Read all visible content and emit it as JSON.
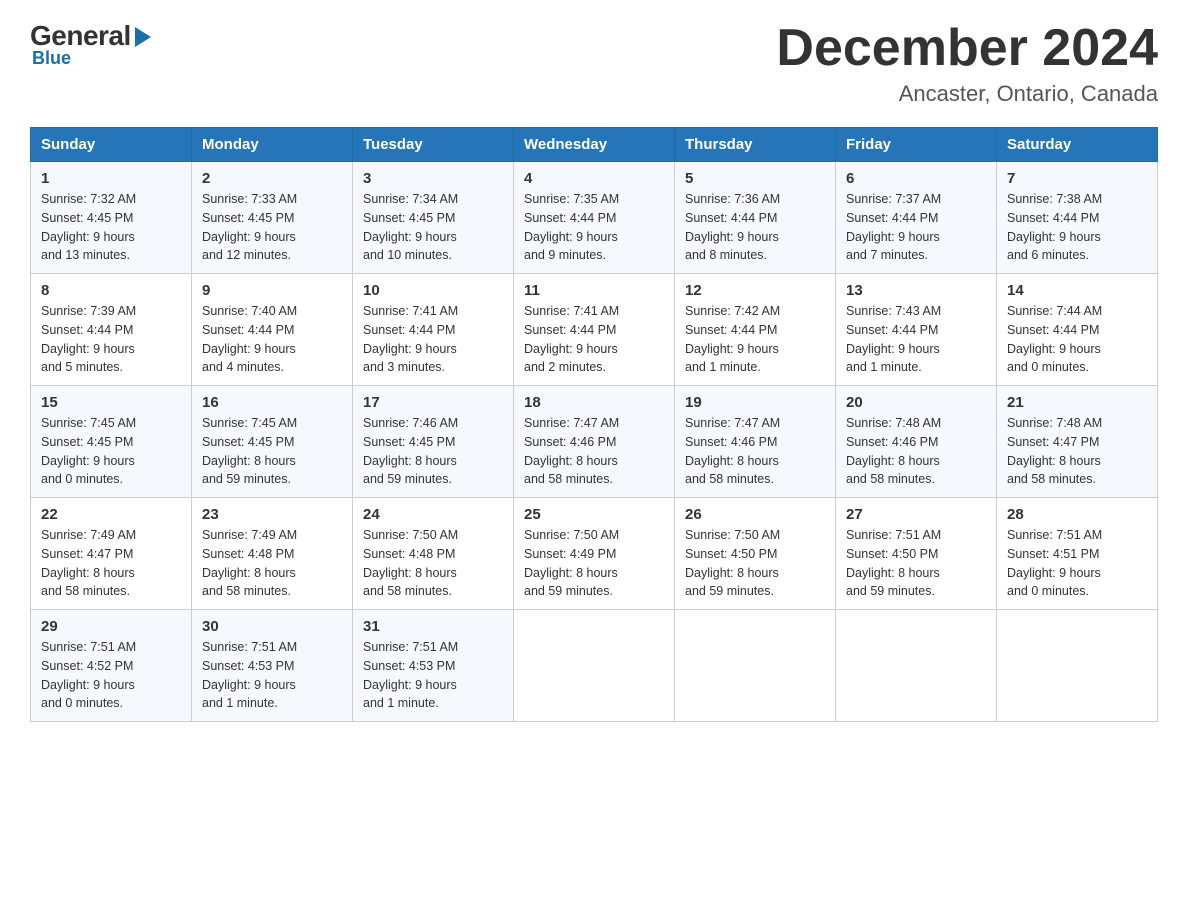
{
  "header": {
    "logo_general": "General",
    "logo_blue": "Blue",
    "month_year": "December 2024",
    "location": "Ancaster, Ontario, Canada"
  },
  "days_of_week": [
    "Sunday",
    "Monday",
    "Tuesday",
    "Wednesday",
    "Thursday",
    "Friday",
    "Saturday"
  ],
  "weeks": [
    [
      {
        "day": "1",
        "sunrise": "7:32 AM",
        "sunset": "4:45 PM",
        "daylight": "9 hours and 13 minutes."
      },
      {
        "day": "2",
        "sunrise": "7:33 AM",
        "sunset": "4:45 PM",
        "daylight": "9 hours and 12 minutes."
      },
      {
        "day": "3",
        "sunrise": "7:34 AM",
        "sunset": "4:45 PM",
        "daylight": "9 hours and 10 minutes."
      },
      {
        "day": "4",
        "sunrise": "7:35 AM",
        "sunset": "4:44 PM",
        "daylight": "9 hours and 9 minutes."
      },
      {
        "day": "5",
        "sunrise": "7:36 AM",
        "sunset": "4:44 PM",
        "daylight": "9 hours and 8 minutes."
      },
      {
        "day": "6",
        "sunrise": "7:37 AM",
        "sunset": "4:44 PM",
        "daylight": "9 hours and 7 minutes."
      },
      {
        "day": "7",
        "sunrise": "7:38 AM",
        "sunset": "4:44 PM",
        "daylight": "9 hours and 6 minutes."
      }
    ],
    [
      {
        "day": "8",
        "sunrise": "7:39 AM",
        "sunset": "4:44 PM",
        "daylight": "9 hours and 5 minutes."
      },
      {
        "day": "9",
        "sunrise": "7:40 AM",
        "sunset": "4:44 PM",
        "daylight": "9 hours and 4 minutes."
      },
      {
        "day": "10",
        "sunrise": "7:41 AM",
        "sunset": "4:44 PM",
        "daylight": "9 hours and 3 minutes."
      },
      {
        "day": "11",
        "sunrise": "7:41 AM",
        "sunset": "4:44 PM",
        "daylight": "9 hours and 2 minutes."
      },
      {
        "day": "12",
        "sunrise": "7:42 AM",
        "sunset": "4:44 PM",
        "daylight": "9 hours and 1 minute."
      },
      {
        "day": "13",
        "sunrise": "7:43 AM",
        "sunset": "4:44 PM",
        "daylight": "9 hours and 1 minute."
      },
      {
        "day": "14",
        "sunrise": "7:44 AM",
        "sunset": "4:44 PM",
        "daylight": "9 hours and 0 minutes."
      }
    ],
    [
      {
        "day": "15",
        "sunrise": "7:45 AM",
        "sunset": "4:45 PM",
        "daylight": "9 hours and 0 minutes."
      },
      {
        "day": "16",
        "sunrise": "7:45 AM",
        "sunset": "4:45 PM",
        "daylight": "8 hours and 59 minutes."
      },
      {
        "day": "17",
        "sunrise": "7:46 AM",
        "sunset": "4:45 PM",
        "daylight": "8 hours and 59 minutes."
      },
      {
        "day": "18",
        "sunrise": "7:47 AM",
        "sunset": "4:46 PM",
        "daylight": "8 hours and 58 minutes."
      },
      {
        "day": "19",
        "sunrise": "7:47 AM",
        "sunset": "4:46 PM",
        "daylight": "8 hours and 58 minutes."
      },
      {
        "day": "20",
        "sunrise": "7:48 AM",
        "sunset": "4:46 PM",
        "daylight": "8 hours and 58 minutes."
      },
      {
        "day": "21",
        "sunrise": "7:48 AM",
        "sunset": "4:47 PM",
        "daylight": "8 hours and 58 minutes."
      }
    ],
    [
      {
        "day": "22",
        "sunrise": "7:49 AM",
        "sunset": "4:47 PM",
        "daylight": "8 hours and 58 minutes."
      },
      {
        "day": "23",
        "sunrise": "7:49 AM",
        "sunset": "4:48 PM",
        "daylight": "8 hours and 58 minutes."
      },
      {
        "day": "24",
        "sunrise": "7:50 AM",
        "sunset": "4:48 PM",
        "daylight": "8 hours and 58 minutes."
      },
      {
        "day": "25",
        "sunrise": "7:50 AM",
        "sunset": "4:49 PM",
        "daylight": "8 hours and 59 minutes."
      },
      {
        "day": "26",
        "sunrise": "7:50 AM",
        "sunset": "4:50 PM",
        "daylight": "8 hours and 59 minutes."
      },
      {
        "day": "27",
        "sunrise": "7:51 AM",
        "sunset": "4:50 PM",
        "daylight": "8 hours and 59 minutes."
      },
      {
        "day": "28",
        "sunrise": "7:51 AM",
        "sunset": "4:51 PM",
        "daylight": "9 hours and 0 minutes."
      }
    ],
    [
      {
        "day": "29",
        "sunrise": "7:51 AM",
        "sunset": "4:52 PM",
        "daylight": "9 hours and 0 minutes."
      },
      {
        "day": "30",
        "sunrise": "7:51 AM",
        "sunset": "4:53 PM",
        "daylight": "9 hours and 1 minute."
      },
      {
        "day": "31",
        "sunrise": "7:51 AM",
        "sunset": "4:53 PM",
        "daylight": "9 hours and 1 minute."
      },
      null,
      null,
      null,
      null
    ]
  ],
  "labels": {
    "sunrise": "Sunrise:",
    "sunset": "Sunset:",
    "daylight": "Daylight:"
  }
}
